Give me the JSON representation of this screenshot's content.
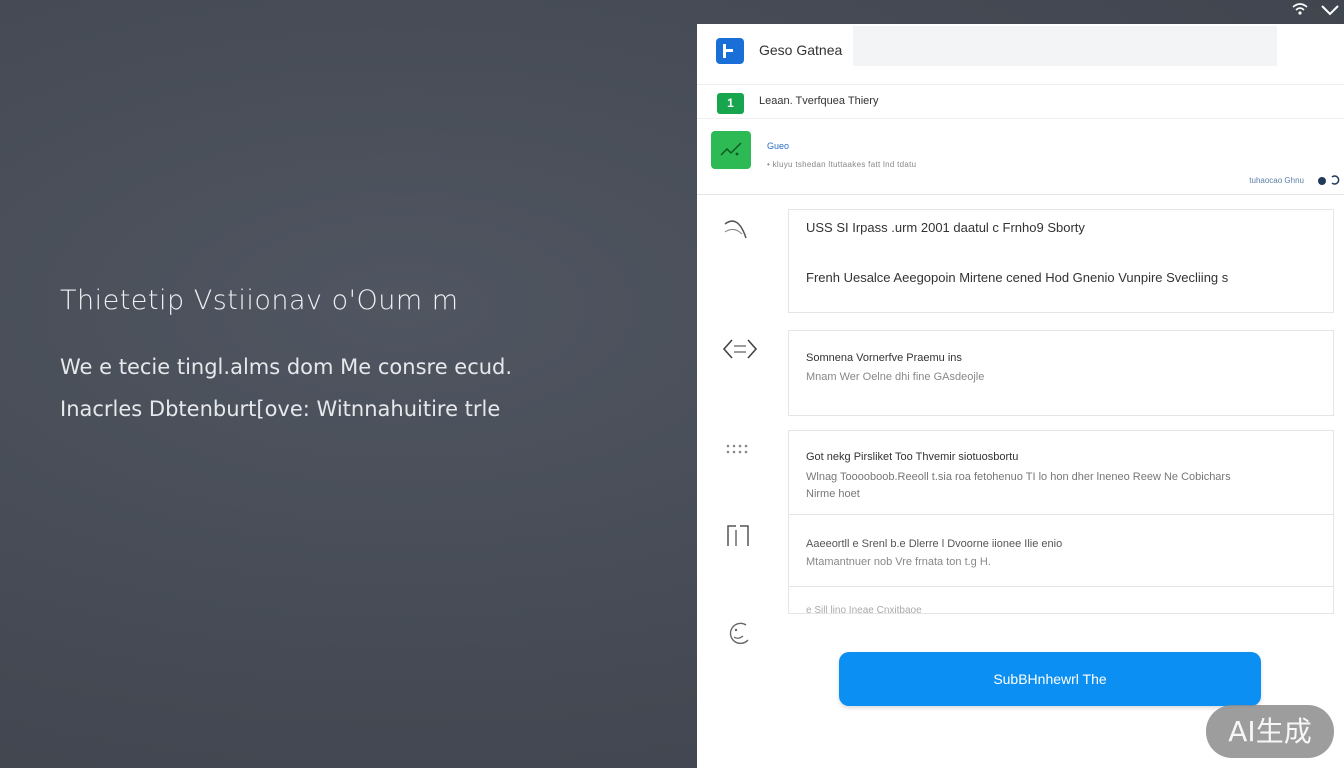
{
  "hero": {
    "title": "Thietetip Vstiionav o'Oum m",
    "line1": "We e tecie tingl.alms dom Me consre ecud.",
    "line2": "Inacrles Dbtenburt[ove: Witnnahuitire trle"
  },
  "system_tray": {
    "icons": [
      "wifi-icon",
      "chevron-down-icon"
    ]
  },
  "panel": {
    "app": {
      "name": "Geso Gatnea",
      "logo_icon": "app-logo-icon",
      "accent": "#1a6ed8"
    },
    "search": {
      "placeholder": ""
    },
    "row1": {
      "badge": "1",
      "label": "Leaan. Tverfquea Thiery",
      "badge_color": "#17a64d"
    },
    "row2": {
      "title": "Gueo",
      "description": "• kluyu tshedan ltuttaakes fatt lnd tdatu",
      "status_link": "tuhaocao Ghnu",
      "tile_color": "#2db954"
    },
    "cards": [
      {
        "icon": "curve-icon",
        "lines": [
          "USS SI Irpass .urm 2001 daatul c Frnho9 Sborty",
          "Frenh Uesalce  Aeegopoin Mirtene cened Hod Gnenio Vunpire Svecliing  s"
        ]
      },
      {
        "icon": "code-arrows-icon",
        "lines": [
          "Somnena Vornerfve  Praemu ins",
          "Mnam Wer Oelne dhi fine GAsdeojle"
        ]
      },
      {
        "icon": "dots-grid-icon",
        "lines": [
          "Got nekg  Pirsliket Too Thvemir siotuosbortu",
          "Wlnag Tooooboob.Reeoll t.sia roa fetohenuo TI lo     hon dher lneneo Reew Ne Cobichars",
          "Nirme hoet"
        ]
      },
      {
        "icon": "bracket-icon",
        "lines": [
          "Aaeeortll e Srenl b.e  Dlerre  l Dvoorne iionee Ilie enio",
          "Mtamantnuer nob  Vre frnata ton t.g  H."
        ]
      },
      {
        "icon": "face-icon",
        "lines": [
          "e Sill  lino  Ineae   Cnxitbaoe"
        ]
      }
    ],
    "cta_label": "SubBHnhewrl The",
    "cta_color": "#0c8ff2"
  },
  "watermark": "AI生成"
}
